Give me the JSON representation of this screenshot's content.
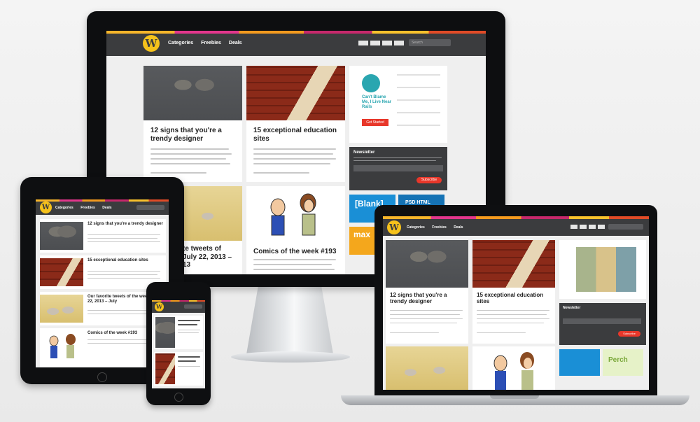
{
  "site": {
    "logo_letter": "W",
    "nav": [
      "Categories",
      "Freebies",
      "Deals"
    ],
    "search_placeholder": "Search"
  },
  "articles": [
    {
      "title": "12 signs that you're a trendy designer",
      "thumb": "bow-tie-photo"
    },
    {
      "title": "15 exceptional education sites",
      "thumb": "brick-wall-photo"
    },
    {
      "title": "Our favorite tweets of the week: July 22, 2013 – July 26, 2013",
      "thumb": "cartoon-illustration"
    },
    {
      "title": "Comics of the week #193",
      "thumb": "comic-illustration"
    }
  ],
  "monitor_visible_titles": {
    "third_partial": "te tweets of",
    "third_partial_line2": "July 22, 2013 –",
    "third_partial_line3": "13"
  },
  "tablet_titles": [
    "12 signs that you're a trendy designer",
    "15 exceptional education sites",
    "Our favorite tweets of the week: July 22, 2013 – July",
    "Comics of the week #193"
  ],
  "sidebar": {
    "ad_text": "Can't Blame Me, I Live Near Rails",
    "ad_button": "Get Started",
    "newsletter_title": "Newsletter",
    "newsletter_button": "Subscribe",
    "blank_ad": "[Blank]",
    "psd_ad": "PSD HTML",
    "max_ad": "max",
    "perch_ad": "Perch"
  },
  "colors": {
    "topbar": "#3b3c3e",
    "logo": "#f6c21b",
    "accent": "#e2368c",
    "button_red": "#e8372a",
    "blank_blue": "#1a8fd6"
  }
}
